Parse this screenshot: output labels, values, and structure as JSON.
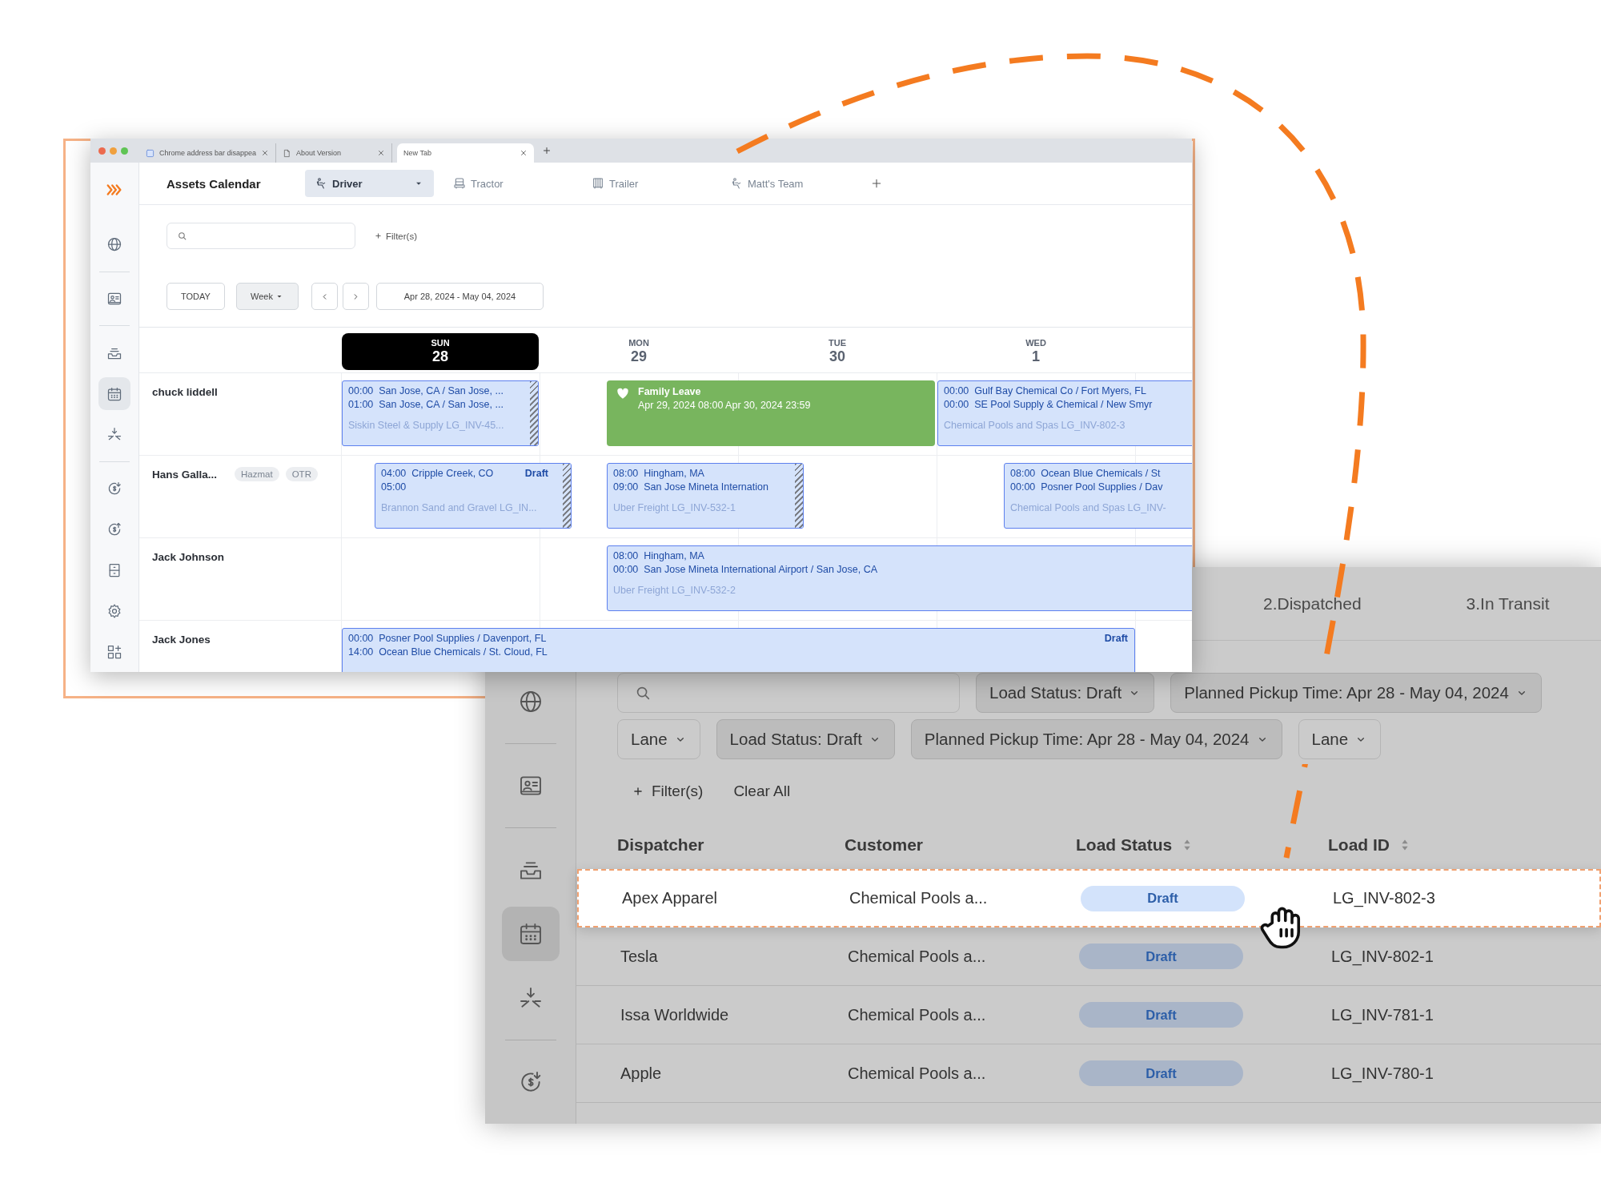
{
  "calendar_window": {
    "browser_tabs": [
      {
        "title": "Chrome address bar disappea",
        "selected": false
      },
      {
        "title": "About Version",
        "selected": false
      },
      {
        "title": "New Tab",
        "selected": true
      }
    ],
    "sidebar": [
      {
        "selected": false
      },
      {
        "selected": false
      },
      {
        "selected": false
      },
      {
        "selected": true
      },
      {
        "selected": false
      },
      {
        "selected": false
      },
      {
        "selected": false
      },
      {
        "selected": false
      },
      {
        "selected": false
      },
      {
        "selected": false
      }
    ],
    "title": "Assets Calendar",
    "asset_tabs": [
      {
        "label": "Driver",
        "selected": true
      },
      {
        "label": "Tractor",
        "selected": false
      },
      {
        "label": "Trailer",
        "selected": false
      },
      {
        "label": "Matt's Team",
        "selected": false
      }
    ],
    "filter_button": "Filter(s)",
    "today_button": "TODAY",
    "view_select": "Week",
    "date_range": "Apr 28, 2024 - May 04, 2024",
    "days": [
      {
        "weekday": "SUN",
        "date": "28",
        "selected": true
      },
      {
        "weekday": "MON",
        "date": "29",
        "selected": false
      },
      {
        "weekday": "TUE",
        "date": "30",
        "selected": false
      },
      {
        "weekday": "WED",
        "date": "1",
        "selected": false
      }
    ],
    "rows": [
      {
        "name": "chuck liddell",
        "events": [
          {
            "kind": "load",
            "lines": [
              "00:00  San Jose, CA / San Jose, ...",
              "01:00  San Jose, CA / San Jose, ..."
            ],
            "footer": "Siskin Steel & Supply LG_INV-45...",
            "hatched": true
          },
          {
            "kind": "leave",
            "title": "Family Leave",
            "period": "Apr 29, 2024 08:00 Apr 30, 2024 23:59"
          },
          {
            "kind": "load",
            "lines": [
              "00:00  Gulf Bay Chemical Co / Fort Myers, FL",
              "00:00  SE Pool Supply & Chemical / New Smyr"
            ],
            "footer": "Chemical Pools and Spas LG_INV-802-3",
            "hatched": false
          }
        ]
      },
      {
        "name": "Hans Galla...",
        "tags": [
          "Hazmat",
          "OTR"
        ],
        "events": [
          {
            "kind": "load",
            "lines": [
              "04:00  Cripple Creek, CO",
              "05:00"
            ],
            "footer": "Brannon Sand and Gravel LG_IN...",
            "draft": "Draft",
            "hatched": true
          },
          {
            "kind": "load",
            "lines": [
              "08:00  Hingham, MA",
              "09:00  San Jose Mineta Internation"
            ],
            "footer": "Uber Freight LG_INV-532-1",
            "hatched": true
          },
          {
            "kind": "load",
            "lines": [
              "08:00  Ocean Blue Chemicals / St",
              "00:00  Posner Pool Supplies / Dav"
            ],
            "footer": "Chemical Pools and Spas LG_INV-",
            "hatched": false
          }
        ]
      },
      {
        "name": "Jack Johnson",
        "events": [
          {
            "kind": "load",
            "lines": [
              "08:00  Hingham, MA",
              "00:00  San Jose Mineta International Airport / San Jose, CA"
            ],
            "footer": "Uber Freight LG_INV-532-2",
            "hatched": false
          }
        ]
      },
      {
        "name": "Jack Jones",
        "events": [
          {
            "kind": "load",
            "lines": [
              "00:00  Posner Pool Supplies / Davenport, FL",
              "14:00  Ocean Blue Chemicals / St. Cloud, FL"
            ],
            "draft": "Draft",
            "hatched": false
          }
        ]
      }
    ]
  },
  "load_board_window": {
    "sidebar": [
      {
        "selected": false
      },
      {
        "selected": false
      },
      {
        "selected": false
      },
      {
        "selected": true
      },
      {
        "selected": false
      },
      {
        "selected": false
      }
    ],
    "status_tabs": [
      {
        "label": "2.Dispatched",
        "selected": false
      },
      {
        "label": "3.In Transit",
        "selected": false
      }
    ],
    "filter_rows": [
      [
        {
          "label": "Load Status: Draft",
          "active": true
        },
        {
          "label": "Planned Pickup Time: Apr 28 - May 04, 2024",
          "active": true
        }
      ],
      [
        {
          "label": "Lane",
          "active": false
        },
        {
          "label": "Load Status: Draft",
          "active": true
        },
        {
          "label": "Planned Pickup Time: Apr 28 - May 04, 2024",
          "active": true
        },
        {
          "label": "Lane",
          "active": false
        }
      ]
    ],
    "filter_button": "Filter(s)",
    "clear_all": "Clear All",
    "columns": [
      {
        "label": "Dispatcher",
        "sortable": false
      },
      {
        "label": "Customer",
        "sortable": false
      },
      {
        "label": "Load Status",
        "sortable": true
      },
      {
        "label": "Load ID",
        "sortable": true
      }
    ],
    "rows": [
      {
        "dispatcher": "Apex Apparel",
        "customer": "Chemical Pools a...",
        "status": "Draft",
        "load_id": "LG_INV-802-3",
        "selected": true
      },
      {
        "dispatcher": "Tesla",
        "customer": "Chemical Pools a...",
        "status": "Draft",
        "load_id": "LG_INV-802-1",
        "selected": false
      },
      {
        "dispatcher": "Issa Worldwide",
        "customer": "Chemical Pools a...",
        "status": "Draft",
        "load_id": "LG_INV-781-1",
        "selected": false
      },
      {
        "dispatcher": "Apple",
        "customer": "Chemical Pools a...",
        "status": "Draft",
        "load_id": "LG_INV-780-1",
        "selected": false
      }
    ]
  }
}
